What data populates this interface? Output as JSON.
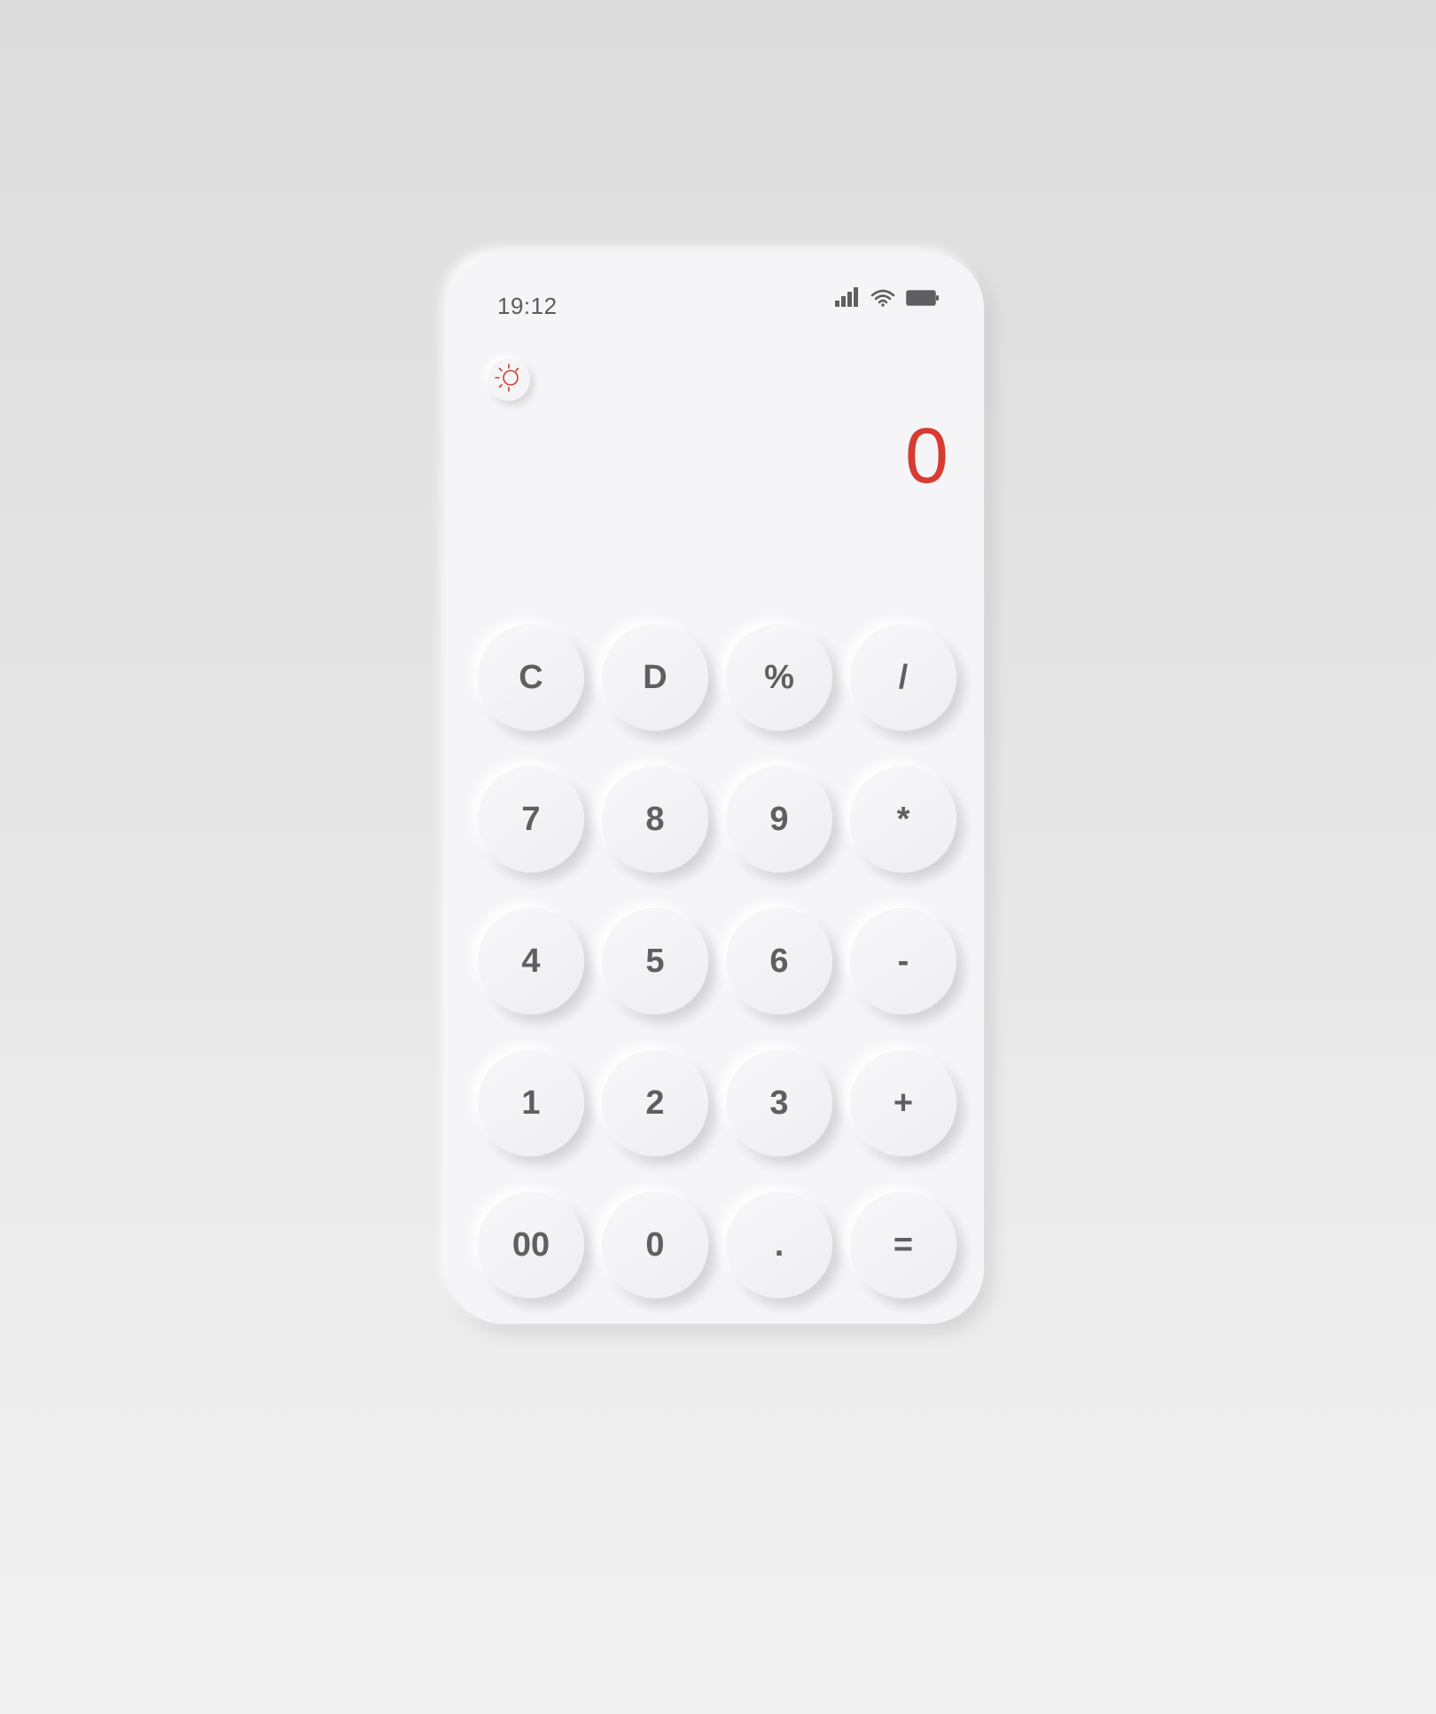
{
  "status_bar": {
    "time": "19:12",
    "icons": [
      "cellular-signal-icon",
      "wifi-icon",
      "battery-icon"
    ]
  },
  "theme_toggle": {
    "icon": "sun-moon-icon",
    "color": "#d83b30"
  },
  "display": {
    "value": "0",
    "color": "#d83b30"
  },
  "keypad": {
    "keys": [
      {
        "label": "C",
        "name": "clear"
      },
      {
        "label": "D",
        "name": "delete"
      },
      {
        "label": "%",
        "name": "percent"
      },
      {
        "label": "/",
        "name": "divide"
      },
      {
        "label": "7",
        "name": "seven"
      },
      {
        "label": "8",
        "name": "eight"
      },
      {
        "label": "9",
        "name": "nine"
      },
      {
        "label": "*",
        "name": "multiply"
      },
      {
        "label": "4",
        "name": "four"
      },
      {
        "label": "5",
        "name": "five"
      },
      {
        "label": "6",
        "name": "six"
      },
      {
        "label": "-",
        "name": "subtract"
      },
      {
        "label": "1",
        "name": "one"
      },
      {
        "label": "2",
        "name": "two"
      },
      {
        "label": "3",
        "name": "three"
      },
      {
        "label": "+",
        "name": "add"
      },
      {
        "label": "00",
        "name": "double-zero"
      },
      {
        "label": "0",
        "name": "zero"
      },
      {
        "label": ".",
        "name": "decimal"
      },
      {
        "label": "=",
        "name": "equals"
      }
    ]
  }
}
